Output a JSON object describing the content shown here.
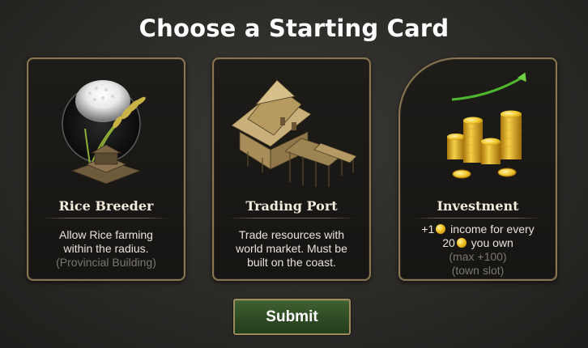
{
  "dialog": {
    "title": "Choose a Starting Card"
  },
  "cards": [
    {
      "title": "Rice Breeder",
      "icon": "rice-farm-icon",
      "description": [
        "Allow Rice farming",
        "within the radius."
      ],
      "note": [
        "(Provincial Building)"
      ]
    },
    {
      "title": "Trading Port",
      "icon": "trading-port-icon",
      "description": [
        "Trade resources with",
        "world market. Must be",
        "built on the coast."
      ],
      "note": []
    },
    {
      "title": "Investment",
      "icon": "gold-coins-icon",
      "description_prefix": "+1",
      "description_mid": " income for every",
      "description_num": "20",
      "description_suffix": " you own",
      "note": [
        "(max +100)",
        "(town slot)"
      ]
    }
  ],
  "submit": {
    "label": "Submit"
  },
  "colors": {
    "card_border": "#8a7650",
    "button_green": "#3f6131",
    "gold": "#f0c020"
  }
}
